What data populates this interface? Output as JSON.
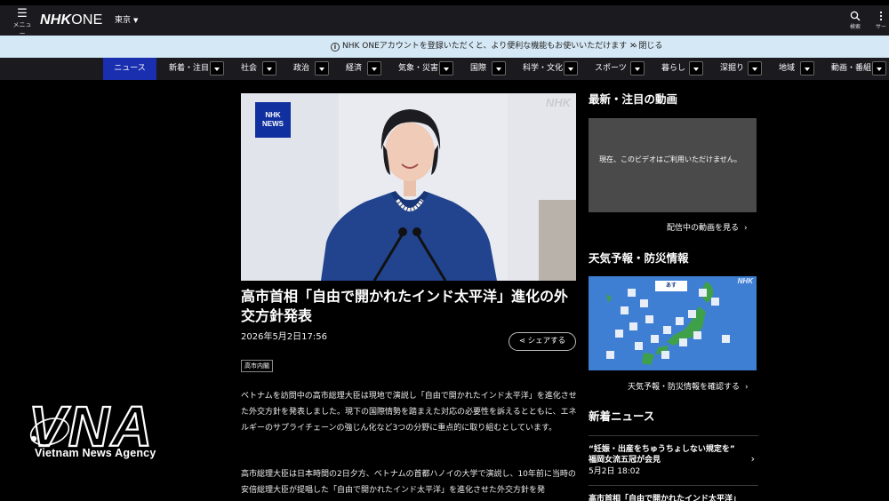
{
  "header": {
    "menu_label": "メニュー",
    "logo_nhk": "NHK",
    "logo_one": "ONE",
    "region": "東京",
    "search_label": "検索",
    "service_label": "サー"
  },
  "banner": {
    "message": "NHK ONEアカウントを登録いただくと、より便利な機能もお使いいただけます",
    "arrow": "›",
    "close_label": "閉じる"
  },
  "nav": {
    "items": [
      "ニュース",
      "新着・注目",
      "社会",
      "政治",
      "経済",
      "気象・災害",
      "国際",
      "科学・文化",
      "スポーツ",
      "暮らし",
      "深掘り",
      "地域",
      "動画・番組"
    ]
  },
  "article": {
    "nhk_badge_line1": "NHK",
    "nhk_badge_line2": "NEWS",
    "watermark": "NHK",
    "headline": "高市首相「自由で開かれたインド太平洋」進化の外交方針発表",
    "date": "2026年5月2日17:56",
    "share_label": "シェアする",
    "tag": "高市内閣",
    "paragraph1": "ベトナムを訪問中の高市総理大臣は現地で演説し「自由で開かれたインド太平洋」を進化させた外交方針を発表しました。現下の国際情勢を踏まえた対応の必要性を訴えるとともに、エネルギーのサプライチェーンの強じん化など3つの分野に重点的に取り組むとしています。",
    "paragraph2": "高市総理大臣は日本時間の2日夕方、ベトナムの首都ハノイの大学で演説し、10年前に当時の安倍総理大臣が提唱した「自由で開かれたインド太平洋」を進化させた外交方針を発"
  },
  "sidebar": {
    "video_title": "最新・注目の動画",
    "video_unavailable": "現在、このビデオはご利用いただけません。",
    "video_link": "配信中の動画を見る",
    "weather_title": "天気予報・防災情報",
    "weather_tab": "あす",
    "weather_watermark": "NHK",
    "weather_link": "天気予報・防災情報を確認する",
    "news_title": "新着ニュース",
    "news": [
      {
        "title": "“妊娠・出産をちゅうちょしない規定を” 福岡女流五冠が会見",
        "date": "5月2日 18:02"
      },
      {
        "title": "高市首相「自由で開かれたインド太平洋」",
        "date": ""
      }
    ]
  },
  "overlay": {
    "vna_logo_text": "VNA",
    "vna_caption": "Vietnam News Agency"
  },
  "colors": {
    "header_bg": "#1b1b1f",
    "banner_bg": "#d5e8f5",
    "nav_active": "#1a2fb0",
    "weather_bg": "#3f7fd3",
    "video_placeholder": "#4a4a4a"
  }
}
